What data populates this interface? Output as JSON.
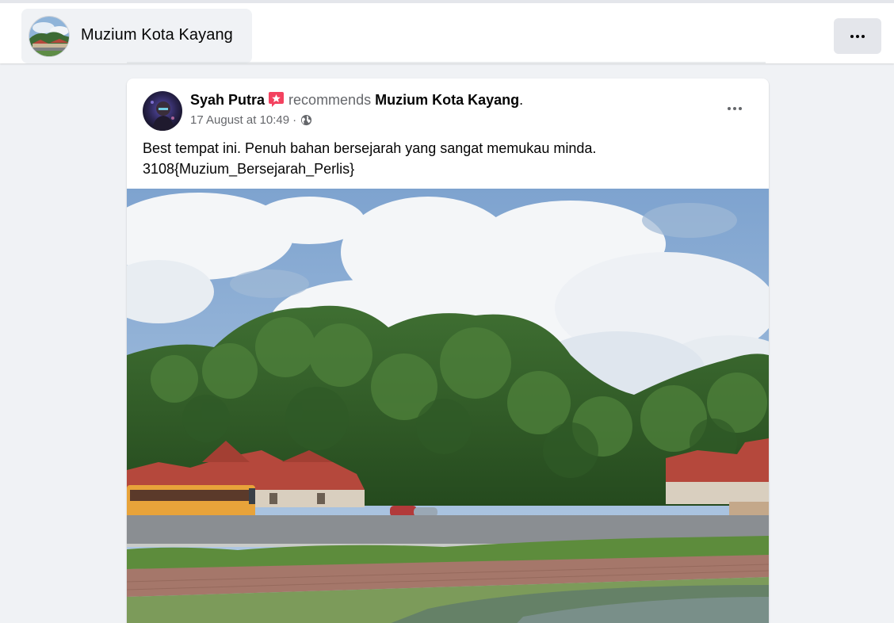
{
  "header": {
    "page_name": "Muzium Kota Kayang",
    "more_icon": "more-horizontal-icon"
  },
  "post": {
    "author": "Syah Putra",
    "recommend_word": "recommends",
    "recommended_page": "Muzium Kota Kayang",
    "period": ".",
    "timestamp": "17 August at 10:49",
    "separator": "·",
    "privacy_icon": "globe-icon",
    "badge_icon": "recommend-star-icon",
    "text_line1": "Best tempat ini. Penuh bahan bersejarah yang sangat memukau minda.",
    "text_line2": "3108{Muzium_Bersejarah_Perlis}",
    "options_icon": "more-horizontal-icon"
  },
  "colors": {
    "background": "#f0f2f5",
    "card": "#ffffff",
    "secondary_text": "#65676b",
    "badge": "#f3425f",
    "button": "#e4e6eb"
  }
}
